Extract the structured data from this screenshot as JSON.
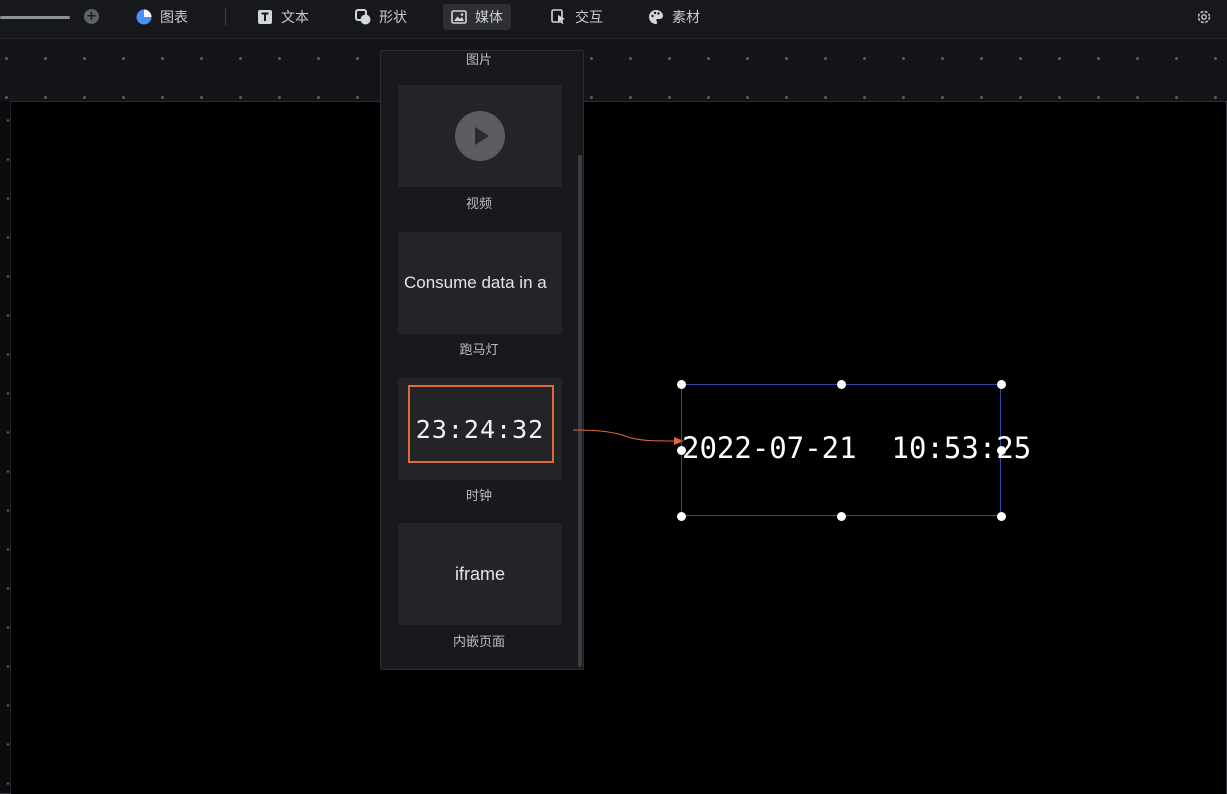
{
  "toolbar": {
    "items": [
      {
        "label": "图表",
        "icon": "pie-chart-icon"
      },
      {
        "label": "文本",
        "icon": "text-icon"
      },
      {
        "label": "形状",
        "icon": "shape-icon"
      },
      {
        "label": "媒体",
        "icon": "image-icon",
        "active": true
      },
      {
        "label": "交互",
        "icon": "pointer-icon"
      },
      {
        "label": "素材",
        "icon": "palette-icon"
      }
    ],
    "accent": "#4a90ff"
  },
  "media_panel": {
    "top_label": "图片",
    "items": [
      {
        "label": "视频",
        "preview": "play"
      },
      {
        "label": "跑马灯",
        "preview": "Consume data in a"
      },
      {
        "label": "时钟",
        "preview": "23:24:32"
      },
      {
        "label": "内嵌页面",
        "preview": "iframe"
      }
    ],
    "highlight_color": "#e0693b"
  },
  "canvas_widget": {
    "text": "2022-07-21  10:53:25",
    "border_color": "#3446a5"
  }
}
